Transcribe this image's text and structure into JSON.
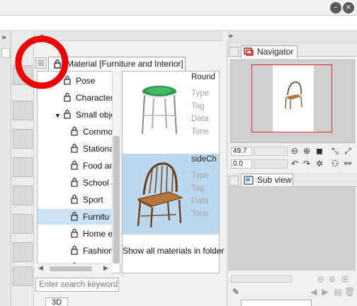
{
  "material_panel": {
    "tab_label": "Material [Furniture and Interior]",
    "tree": [
      {
        "label": "Pose",
        "indent": 0,
        "icon": "pose-icon"
      },
      {
        "label": "Character",
        "indent": 0,
        "icon": "character-icon"
      },
      {
        "label": "Small obje",
        "indent": 0,
        "icon": "folder-bag-icon",
        "expanded": true
      },
      {
        "label": "Commo",
        "indent": 1,
        "icon": "bag-icon"
      },
      {
        "label": "Stationa",
        "indent": 1,
        "icon": "bag-icon"
      },
      {
        "label": "Food an",
        "indent": 1,
        "icon": "bag-icon"
      },
      {
        "label": "School a",
        "indent": 1,
        "icon": "bag-icon"
      },
      {
        "label": "Sport",
        "indent": 1,
        "icon": "bag-icon"
      },
      {
        "label": "Furnitu",
        "indent": 1,
        "icon": "bag-icon",
        "selected": true
      },
      {
        "label": "Home el",
        "indent": 1,
        "icon": "bag-icon"
      },
      {
        "label": "Fashion",
        "indent": 1,
        "icon": "bag-icon"
      },
      {
        "label": "Tool",
        "indent": 1,
        "icon": "bag-icon"
      }
    ],
    "materials": [
      {
        "name": "Round",
        "props": [
          "Type",
          "Tag",
          "Data",
          "Tone"
        ],
        "selected": false
      },
      {
        "name": "sideCh",
        "props": [
          "Type",
          "Tag",
          "Data",
          "Tone"
        ],
        "selected": true
      }
    ],
    "show_all_label": "Show all materials in folder",
    "search_placeholder": "Enter search keyword",
    "chip_3d": "3D"
  },
  "navigator": {
    "tab_label": "Navigator",
    "zoom_value": "49.7",
    "rotate_value": "0.0",
    "frame_color": "#e03030"
  },
  "subview": {
    "tab_label": "Sub view"
  },
  "title_buttons": {
    "minimize": "–",
    "close": "×"
  },
  "annotation": {
    "circle_color": "#ee0000"
  },
  "colors": {
    "selected_bg": "#bcd8ee"
  }
}
